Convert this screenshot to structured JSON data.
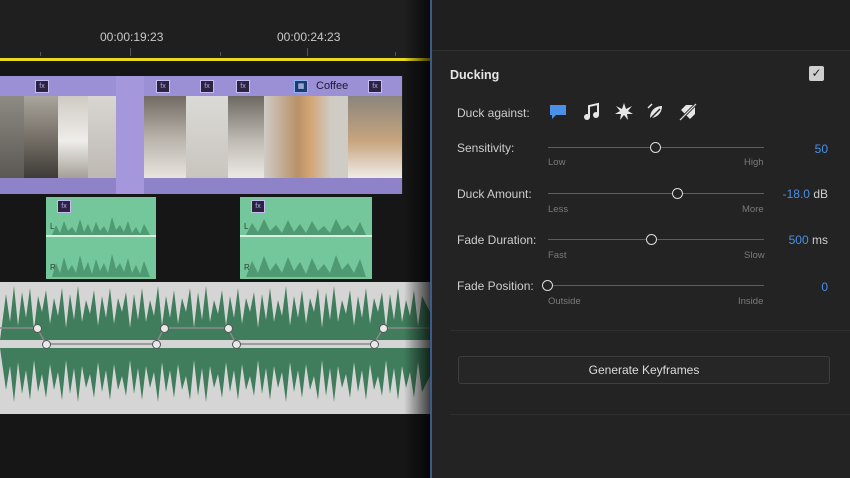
{
  "timeline": {
    "timecodes": [
      "00:00:19:23",
      "00:00:24:23"
    ],
    "clip_label": "Coffee",
    "fx_badge": "fx",
    "track_letters": [
      "L",
      "R"
    ]
  },
  "ducking": {
    "title": "Ducking",
    "enabled": true,
    "duck_against_label": "Duck against:",
    "duck_against_icons": [
      "dialogue-icon",
      "music-icon",
      "sfx-icon",
      "ambience-icon",
      "untagged-icon"
    ],
    "sensitivity": {
      "label": "Sensitivity:",
      "min_label": "Low",
      "max_label": "High",
      "value": "50",
      "unit": "",
      "level": 0.5
    },
    "duck_amount": {
      "label": "Duck Amount:",
      "min_label": "Less",
      "max_label": "More",
      "value": "-18.0",
      "unit": "dB",
      "level": 0.6
    },
    "fade_duration": {
      "label": "Fade Duration:",
      "min_label": "Fast",
      "max_label": "Slow",
      "value": "500",
      "unit": "ms",
      "level": 0.48
    },
    "fade_position": {
      "label": "Fade Position:",
      "min_label": "Outside",
      "max_label": "Inside",
      "value": "0",
      "unit": "",
      "level": 0.0
    },
    "generate_button": "Generate Keyframes"
  },
  "colors": {
    "accent": "#4b8fe6",
    "clip_purple": "#9b8fd6",
    "audio_green": "#73c79a",
    "playhead": "#e8d81e"
  }
}
